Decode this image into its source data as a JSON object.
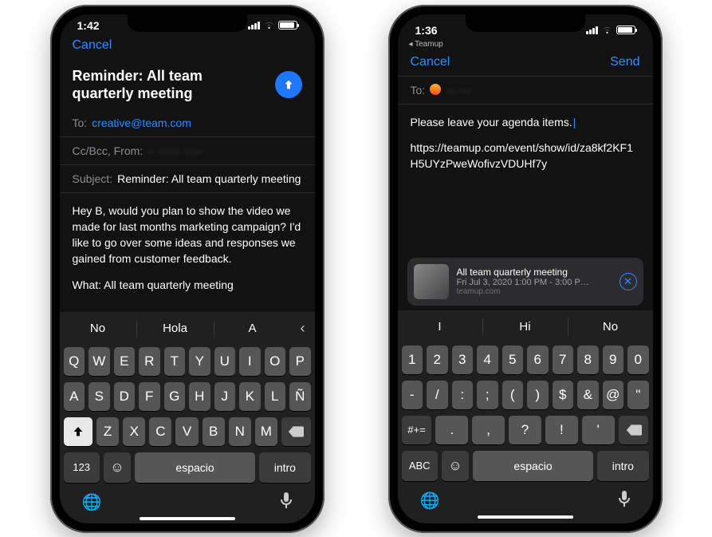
{
  "left": {
    "status": {
      "time": "1:42"
    },
    "nav": {
      "cancel": "Cancel"
    },
    "title": "Reminder: All team quarterly meeting",
    "to": {
      "label": "To:",
      "value": "creative@team.com"
    },
    "cc": {
      "label": "Cc/Bcc, From:",
      "value": "·· ······ ·····"
    },
    "subject": {
      "label": "Subject:",
      "value": "Reminder: All team quarterly meeting"
    },
    "body": {
      "p1": "Hey B, would you plan to show the video we made for last months marketing campaign? I'd like to go over some ideas and responses we gained from customer feedback.",
      "p2": "What: All team quarterly meeting"
    },
    "keyboard": {
      "suggestions": [
        "No",
        "Hola",
        "A"
      ],
      "rows": [
        [
          "Q",
          "W",
          "E",
          "R",
          "T",
          "Y",
          "U",
          "I",
          "O",
          "P"
        ],
        [
          "A",
          "S",
          "D",
          "F",
          "G",
          "H",
          "J",
          "K",
          "L",
          "Ñ"
        ],
        [
          "Z",
          "X",
          "C",
          "V",
          "B",
          "N",
          "M"
        ]
      ],
      "mode": "123",
      "space": "espacio",
      "enter": "intro"
    }
  },
  "right": {
    "status": {
      "time": "1:36",
      "back_app": "Teamup"
    },
    "nav": {
      "cancel": "Cancel",
      "send": "Send"
    },
    "to": {
      "label": "To:",
      "value": "··· ···"
    },
    "body": {
      "p1": "Please leave your agenda items.",
      "p2": "https://teamup.com/event/show/id/za8kf2KF1H5UYzPweWofivzVDUHf7y"
    },
    "attachment": {
      "title": "All team quarterly meeting",
      "subtitle": "Fri Jul 3, 2020 1:00 PM - 3:00 P…",
      "source": "teamup.com"
    },
    "keyboard": {
      "suggestions": [
        "I",
        "Hi",
        "No"
      ],
      "rows": [
        [
          "1",
          "2",
          "3",
          "4",
          "5",
          "6",
          "7",
          "8",
          "9",
          "0"
        ],
        [
          "-",
          "/",
          ":",
          ";",
          "(",
          ")",
          "$",
          "&",
          "@",
          "\""
        ],
        [
          ".",
          ",",
          "?",
          "!",
          "'"
        ]
      ],
      "mode": "ABC",
      "alt": "#+=",
      "space": "espacio",
      "enter": "intro"
    }
  }
}
